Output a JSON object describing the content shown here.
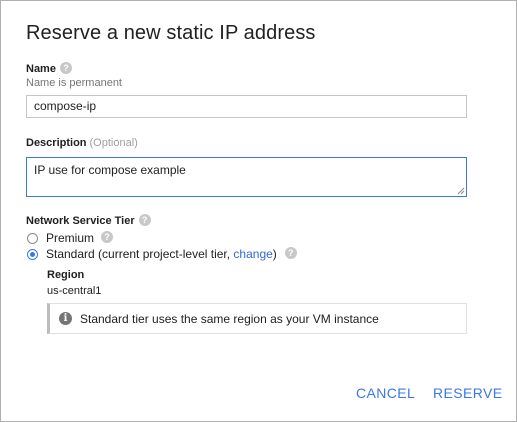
{
  "dialog": {
    "title": "Reserve a new static IP address"
  },
  "name_field": {
    "label": "Name",
    "help_icon": "question-circle-icon",
    "hint": "Name is permanent",
    "value": "compose-ip"
  },
  "description_field": {
    "label": "Description",
    "optional_label": "(Optional)",
    "value": "IP use for compose example"
  },
  "network_tier": {
    "label": "Network Service Tier",
    "help_icon": "question-circle-icon",
    "options": [
      {
        "label": "Premium",
        "selected": false
      },
      {
        "label_prefix": "Standard (current project-level tier, ",
        "link_text": "change",
        "label_suffix": ")",
        "selected": true
      }
    ]
  },
  "region": {
    "label": "Region",
    "value": "us-central1",
    "info_icon": "info-icon",
    "info_text": "Standard tier uses the same region as your VM instance"
  },
  "actions": {
    "cancel_label": "CANCEL",
    "reserve_label": "RESERVE"
  },
  "colors": {
    "accent": "#3b78e7",
    "link": "#3367d6"
  }
}
